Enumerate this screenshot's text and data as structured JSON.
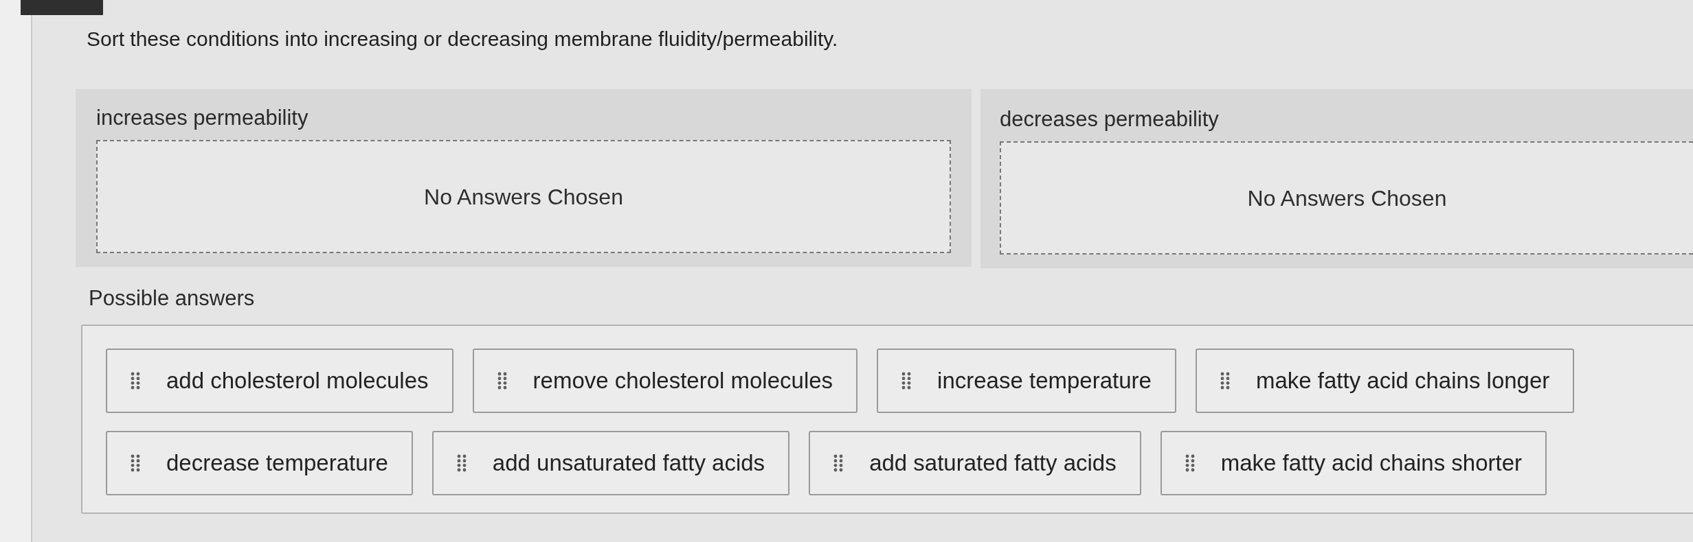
{
  "question": "Sort these conditions into increasing or decreasing membrane fluidity/permeability.",
  "categories": [
    {
      "label": "increases permeability",
      "empty_message": "No Answers Chosen"
    },
    {
      "label": "decreases permeability",
      "empty_message": "No Answers Chosen"
    }
  ],
  "answer_bank": {
    "title": "Possible answers",
    "answers": [
      "add cholesterol molecules",
      "remove cholesterol molecules",
      "increase temperature",
      "make fatty acid chains longer",
      "decrease temperature",
      "add unsaturated fatty acids",
      "add saturated fatty acids",
      "make fatty acid chains shorter"
    ]
  }
}
